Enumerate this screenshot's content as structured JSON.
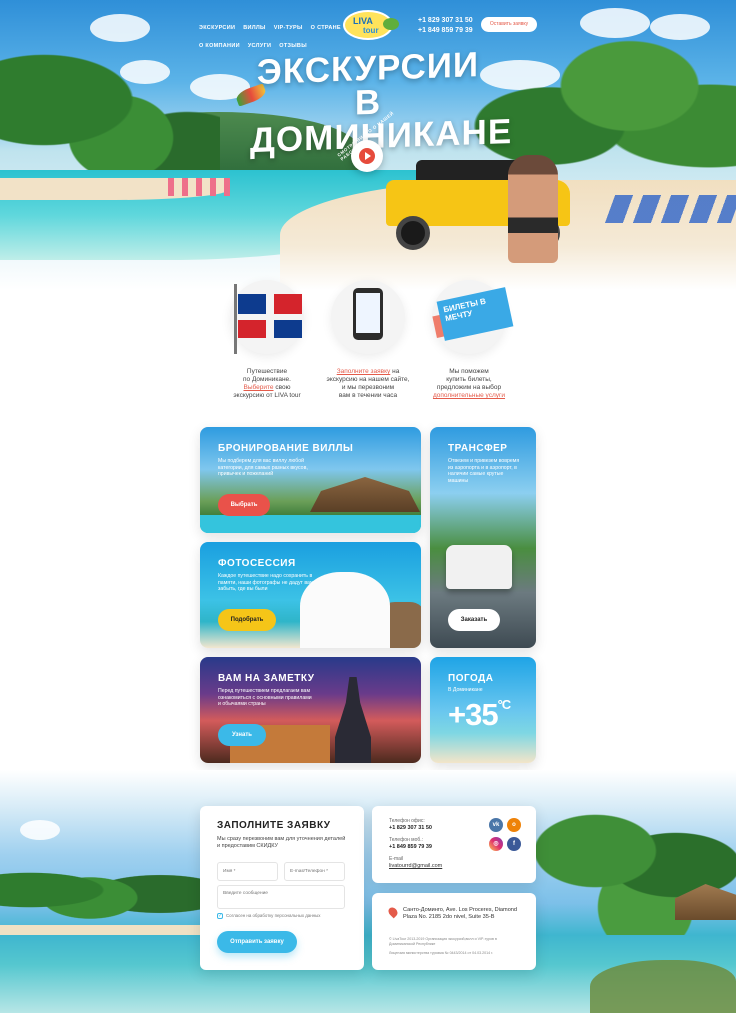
{
  "header": {
    "nav": [
      "ЭКСКУРСИИ",
      "ВИЛЛЫ",
      "VIP-ТУРЫ",
      "О СТРАНЕ",
      "О КОМПАНИИ",
      "УСЛУГИ",
      "ОТЗЫВЫ"
    ],
    "logo_main": "LIVA",
    "logo_sub": "tour",
    "phones": [
      "+1 829 307 31 50",
      "+1 849 859 79 39"
    ],
    "cta_label": "Оставить заявку"
  },
  "hero": {
    "title_line1": "ЭКСКУРСИИ",
    "title_line2": "В ДОМИНИКАНЕ",
    "video_caption": "СМОТРИ ВИДЕО О НАШЕЙ РАБОТЕ"
  },
  "steps": [
    {
      "line1": "Путешествие",
      "line2": "по Доминикане.",
      "link": "Выберите",
      "line3": " свою",
      "line4": "экскурсию от LIVA tour"
    },
    {
      "link": "Заполните заявку",
      "line1": " на",
      "line2": "экскурсию на нашем сайте,",
      "line3": "и мы перезвоним",
      "line4": "вам в течении часа"
    },
    {
      "line1": "Мы поможем",
      "line2": "купить билеты,",
      "line3": "предложим на выбор",
      "link": "дополнительные услуги"
    }
  ],
  "ticket_text": "БИЛЕТЫ В МЕЧТУ",
  "cards": {
    "villa": {
      "title": "БРОНИРОВАНИЕ ВИЛЛЫ",
      "text": "Мы подберем для вас виллу любой категории, для самых разных вкусов, привычек и пожеланий",
      "button": "Выбрать",
      "button_color": "#e9524a"
    },
    "transfer": {
      "title": "ТРАНСФЕР",
      "text": "Отвезем и привезем вовремя из аэропорта и в аэропорт, в наличии самые крутые машины",
      "button": "Заказать",
      "button_color": "#ffffff"
    },
    "photo": {
      "title": "ФОТОСЕССИЯ",
      "text": "Каждое путешествие надо сохранить в памяти, наши фотографы не дадут вам забыть, где вы были",
      "button": "Подобрать",
      "button_color": "#f5c518"
    },
    "notes": {
      "title": "ВАМ НА ЗАМЕТКУ",
      "text": "Перед путешествием предлагаем вам ознакомиться с основными правилами и обычаями страны",
      "button": "Узнать",
      "button_color": "#3bb9e8"
    },
    "weather": {
      "title": "ПОГОДА",
      "subtitle": "В Доминикане",
      "temp": "+35",
      "unit": "°C"
    }
  },
  "form": {
    "title": "ЗАПОЛНИТЕ ЗАЯВКУ",
    "desc": "Мы сразу перезвоним вам для уточнения деталей и предоставим СКИДКУ",
    "name_placeholder": "Имя *",
    "contact_placeholder": "E-mail/Телефон *",
    "message_placeholder": "Введите сообщение",
    "agree": "Согласен на обработку персональных данных",
    "submit": "Отправить заявку"
  },
  "contacts": {
    "office_label": "Телефон офис:",
    "office_phone": "+1 829 307 31 50",
    "mobile_label": "Телефон моб.:",
    "mobile_phone": "+1 849 859 79 39",
    "email_label": "E-mail",
    "email": "livatourrd@gmail.com",
    "social": [
      "vk",
      "ok",
      "instagram",
      "facebook"
    ]
  },
  "address": {
    "text": "Санто-Доминго, Ave. Los Proceres, Diamond Plaza No. 2185 2do nivel, Suite 35-B",
    "copyright": "© LivaTour 2013-2019 Организация экскурсий,вилл и VIP-туров в Доминиканской Республике",
    "license": "Лицензия министерства туризма № 0443/2014 от 04.03.2014 г."
  }
}
